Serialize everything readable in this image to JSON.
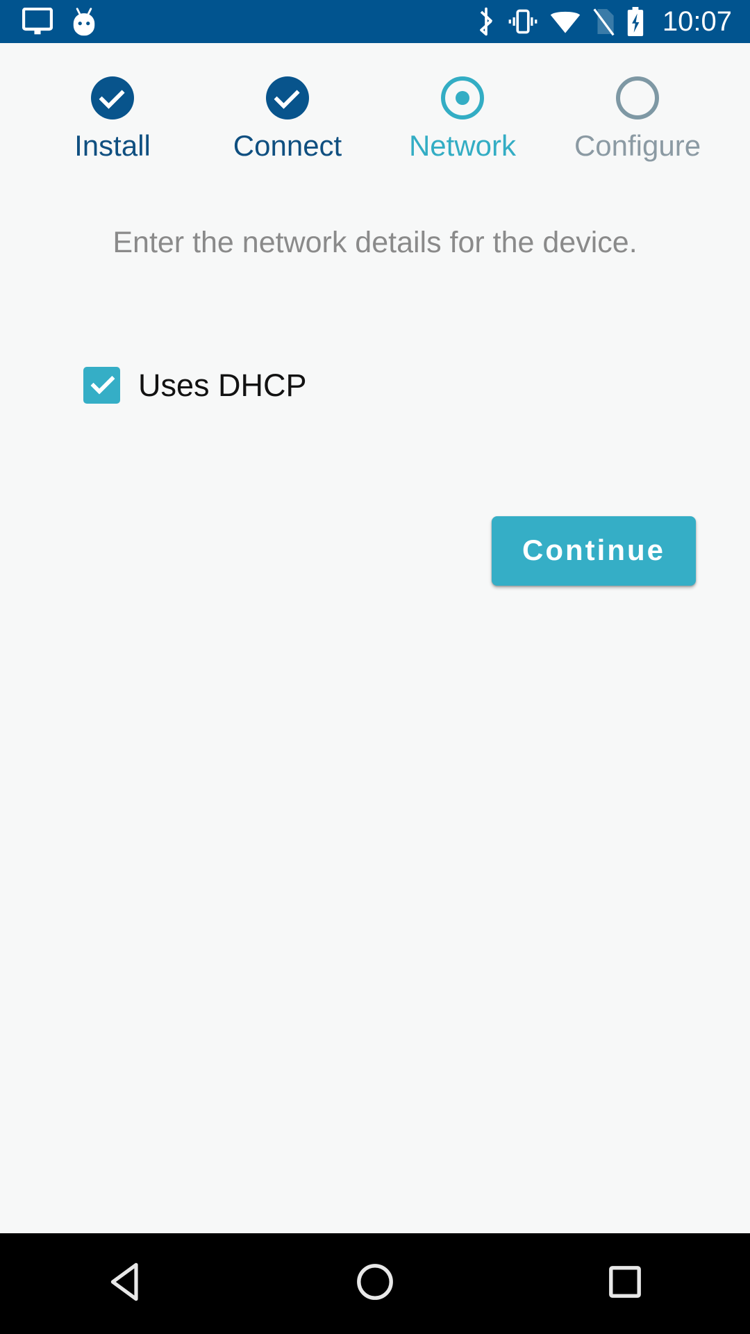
{
  "status_bar": {
    "background_color": "#01548f",
    "left_icons": [
      {
        "name": "cast-screen-icon",
        "label": "cast"
      },
      {
        "name": "android-mascot-icon",
        "label": "android-easter-egg"
      }
    ],
    "right_icons": [
      {
        "name": "bluetooth-icon",
        "label": "bluetooth"
      },
      {
        "name": "vibrate-mode-icon",
        "label": "vibrate"
      },
      {
        "name": "wifi-icon",
        "label": "wifi-full"
      },
      {
        "name": "no-sim-icon",
        "label": "no-sim-card"
      },
      {
        "name": "battery-charging-icon",
        "label": "battery-charging"
      }
    ],
    "clock": "10:07"
  },
  "stepper": {
    "active_color": "#33adc4",
    "done_color": "#08548c",
    "pending_color": "#7e98a4",
    "steps": [
      {
        "label": "Install",
        "state": "done"
      },
      {
        "label": "Connect",
        "state": "done"
      },
      {
        "label": "Network",
        "state": "active"
      },
      {
        "label": "Configure",
        "state": "pending"
      }
    ]
  },
  "main": {
    "instruction": "Enter the network details for the device.",
    "dhcp": {
      "label": "Uses DHCP",
      "checked": true,
      "accent_color": "#35aec6"
    },
    "continue": {
      "label": "Continue",
      "background_color": "#35aec6",
      "text_color": "#ffffff"
    }
  },
  "nav_bar": {
    "background_color": "#000000",
    "buttons": [
      {
        "name": "nav-back-button",
        "label": "Back"
      },
      {
        "name": "nav-home-button",
        "label": "Home"
      },
      {
        "name": "nav-recents-button",
        "label": "Recents"
      }
    ]
  }
}
